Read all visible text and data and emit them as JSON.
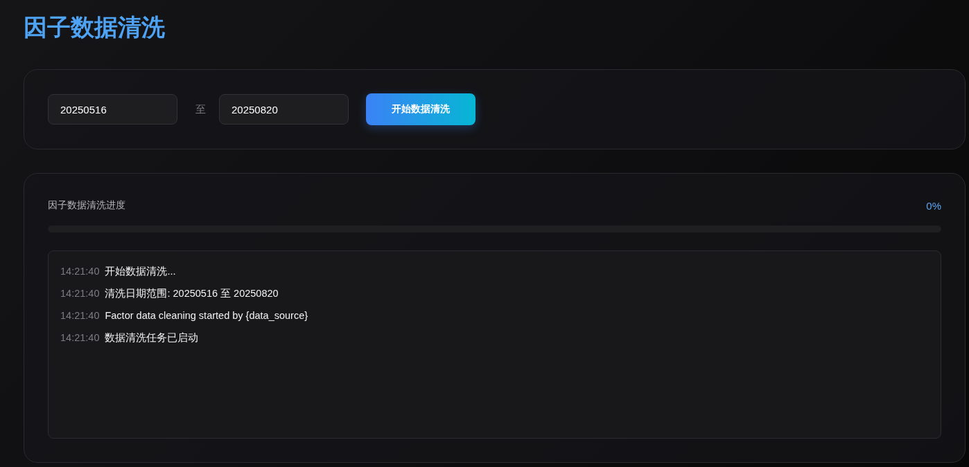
{
  "title": "因子数据清洗",
  "date_range": {
    "start": {
      "value": "20250516"
    },
    "separator": "至",
    "end": {
      "value": "20250820"
    }
  },
  "start_button": "开始数据清洗",
  "progress": {
    "label": "因子数据清洗进度",
    "percent": "0%",
    "level": 0
  },
  "log": [
    {
      "time": "14:21:40",
      "message": "开始数据清洗..."
    },
    {
      "time": "14:21:40",
      "message": "清洗日期范围: 20250516 至 20250820"
    },
    {
      "time": "14:21:40",
      "message": "Factor data cleaning started by {data_source}"
    },
    {
      "time": "14:21:40",
      "message": "数据清洗任务已启动"
    }
  ]
}
